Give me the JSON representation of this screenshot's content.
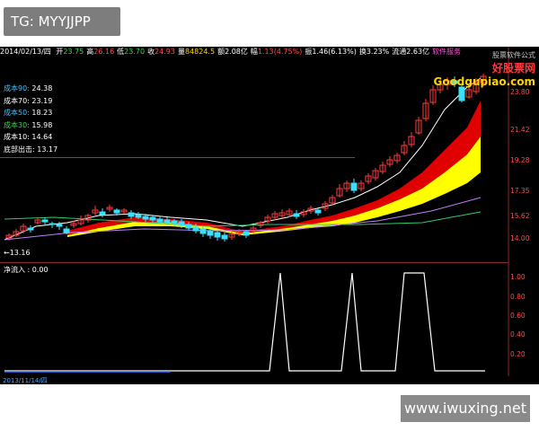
{
  "overlay": {
    "tag": "TG: MYYJJPP",
    "watermark": "www.iwuxing.net"
  },
  "header": {
    "date": "2014/02/13/四",
    "fields": [
      {
        "label": "开",
        "value": "23.75",
        "color": "#39d353"
      },
      {
        "label": "高",
        "value": "26.16",
        "color": "#ff4a4a"
      },
      {
        "label": "低",
        "value": "23.70",
        "color": "#39d353"
      },
      {
        "label": "收",
        "value": "24.93",
        "color": "#ff4a4a"
      },
      {
        "label": "量",
        "value": "84824.5",
        "color": "#ffd400"
      },
      {
        "label": "额",
        "value": "2.08亿",
        "color": "#ffffff"
      },
      {
        "label": "幅",
        "value": "1.13(4.75%)",
        "color": "#ff4a4a"
      },
      {
        "label": "振",
        "value": "1.46(6.13%)",
        "color": "#ffffff"
      },
      {
        "label": "换",
        "value": "3.23%",
        "color": "#ffffff"
      },
      {
        "label": "流通",
        "value": "2.63亿",
        "color": "#ffffff"
      },
      {
        "label": "",
        "value": "软件服务",
        "color": "#ff4fd8"
      }
    ]
  },
  "brand": {
    "top": "股票软件公式",
    "main": "好股票网",
    "sub": "Goodgupiao.com"
  },
  "legend": [
    {
      "label": "成本90:",
      "value": "24.38",
      "color": "#39c5ff"
    },
    {
      "label": "成本70:",
      "value": "23.19",
      "color": "#ffffff"
    },
    {
      "label": "成本50:",
      "value": "18.23",
      "color": "#39c5ff"
    },
    {
      "label": "成本30:",
      "value": "15.98",
      "color": "#39d353"
    },
    {
      "label": "成本10:",
      "value": "14.64",
      "color": "#ffffff"
    },
    {
      "label": "底部出击:",
      "value": "13.17",
      "color": "#ffffff"
    }
  ],
  "main_chart": {
    "low_marker": "←13.16",
    "y_ticks": [
      "23.80",
      "21.42",
      "19.28",
      "17.35",
      "15.62",
      "14.00"
    ],
    "colors": {
      "up": "#ff3b3b",
      "down": "#39e0ff",
      "band_red": "#e00000",
      "band_yellow": "#ffff00",
      "ma_white": "#ffffff",
      "ma_purple": "#c080ff",
      "ma_green": "#2ecc71"
    }
  },
  "lower_chart": {
    "label": "净流入 : 0.00",
    "y_ticks": [
      "1.00",
      "0.80",
      "0.60",
      "0.40",
      "0.20"
    ]
  },
  "footer": {
    "date": "2013/11/14/四"
  }
}
